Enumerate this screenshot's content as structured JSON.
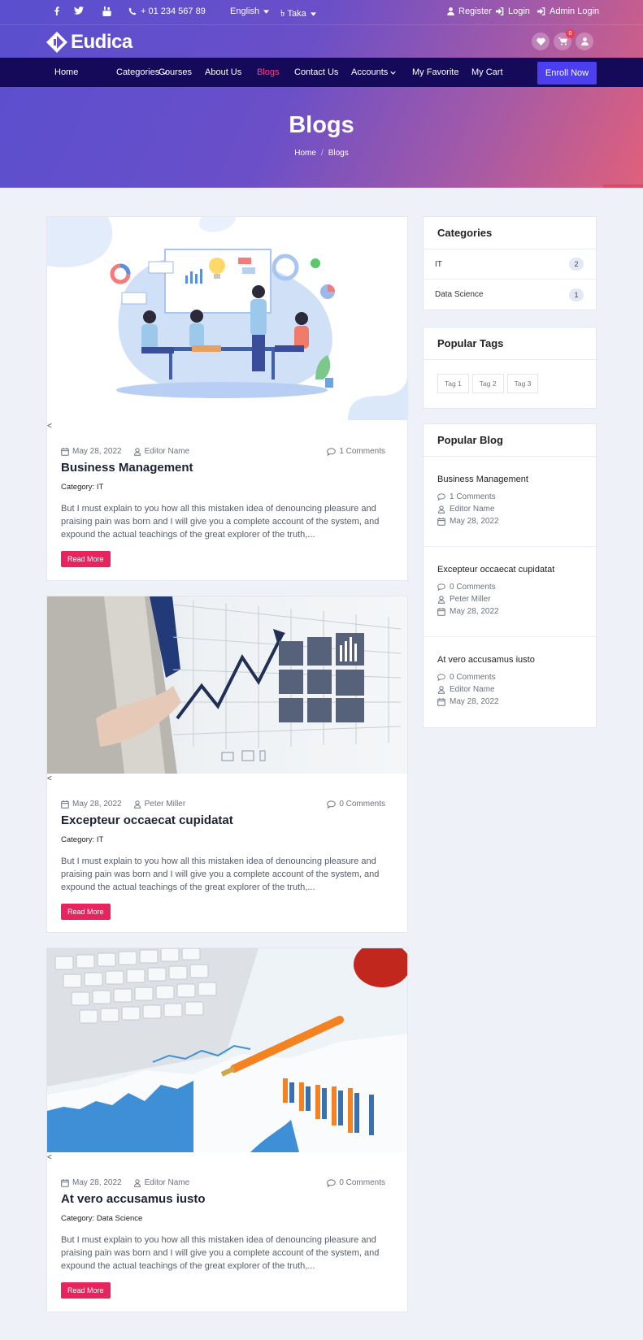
{
  "topbar": {
    "phone": "+ 01 234 567 89",
    "language": "English",
    "currency": "৳ Taka",
    "register": "Register",
    "login": "Login",
    "admin_login": "Admin Login"
  },
  "brand": {
    "name": "Eudica",
    "cart_count": "0"
  },
  "nav": {
    "home": "Home",
    "categories": "Categories",
    "courses": "Courses",
    "about": "About Us",
    "blogs": "Blogs",
    "contact": "Contact Us",
    "accounts": "Accounts",
    "favorite": "My Favorite",
    "cart": "My Cart",
    "enroll": "Enroll Now"
  },
  "hero": {
    "title": "Blogs",
    "crumb_home": "Home",
    "crumb_current": "Blogs"
  },
  "posts": [
    {
      "date": "May 28, 2022",
      "author": "Editor Name",
      "comments": "1 Comments",
      "title": "Business Management",
      "category": "Category: IT",
      "excerpt": "But I must explain to you how all this mistaken idea of denouncing pleasure and praising pain was born and I will give you a complete account of the system, and expound the actual teachings of the great explorer of the truth,...",
      "read_more": "Read More",
      "arrow": "<"
    },
    {
      "date": "May 28, 2022",
      "author": "Peter Miller",
      "comments": "0 Comments",
      "title": "Excepteur occaecat cupidatat",
      "category": "Category: IT",
      "excerpt": "But I must explain to you how all this mistaken idea of denouncing pleasure and praising pain was born and I will give you a complete account of the system, and expound the actual teachings of the great explorer of the truth,...",
      "read_more": "Read More",
      "arrow": "<"
    },
    {
      "date": "May 28, 2022",
      "author": "Editor Name",
      "comments": "0 Comments",
      "title": "At vero accusamus iusto",
      "category": "Category: Data Science",
      "excerpt": "But I must explain to you how all this mistaken idea of denouncing pleasure and praising pain was born and I will give you a complete account of the system, and expound the actual teachings of the great explorer of the truth,...",
      "read_more": "Read More",
      "arrow": "<"
    }
  ],
  "sidebar": {
    "categories_title": "Categories",
    "categories": [
      {
        "name": "IT",
        "count": "2"
      },
      {
        "name": "Data Science",
        "count": "1"
      }
    ],
    "tags_title": "Popular Tags",
    "tags": [
      "Tag 1",
      "Tag 2",
      "Tag 3"
    ],
    "popular_title": "Popular Blog",
    "popular": [
      {
        "title": "Business Management",
        "comments": "1 Comments",
        "author": "Editor Name",
        "date": "May 28, 2022"
      },
      {
        "title": "Excepteur occaecat cupidatat",
        "comments": "0 Comments",
        "author": "Peter Miller",
        "date": "May 28, 2022"
      },
      {
        "title": "At vero accusamus iusto",
        "comments": "0 Comments",
        "author": "Editor Name",
        "date": "May 28, 2022"
      }
    ]
  }
}
